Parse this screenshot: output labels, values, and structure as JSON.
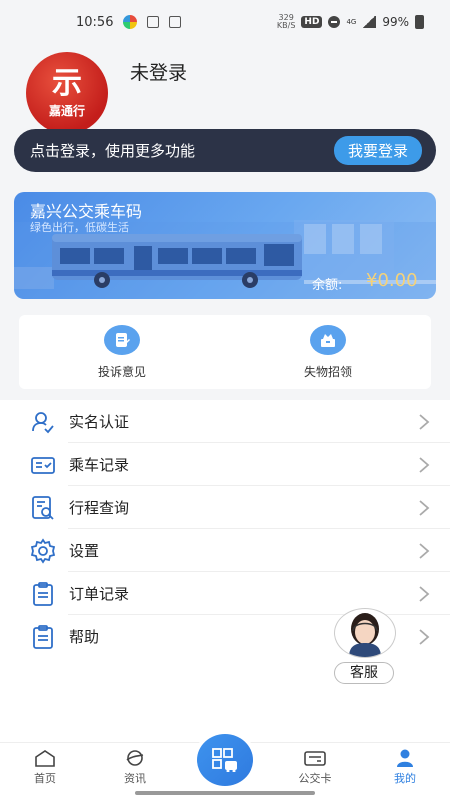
{
  "status_bar": {
    "time": "10:56",
    "speed_value": "329",
    "speed_unit": "KB/S",
    "hd": "HD",
    "network": "4G",
    "battery": "99%"
  },
  "profile": {
    "logo_glyph": "示",
    "logo_text": "嘉通行",
    "username": "未登录"
  },
  "login_banner": {
    "text": "点击登录，使用更多功能",
    "button_label": "我要登录"
  },
  "bus_card": {
    "title": "嘉兴公交乘车码",
    "subtitle": "绿色出行，低碳生活",
    "balance_label": "余额:",
    "balance_value": "¥0.00"
  },
  "services": [
    {
      "label": "投诉意见",
      "icon": "edit-icon"
    },
    {
      "label": "失物招领",
      "icon": "lost-found-icon"
    }
  ],
  "menu": [
    {
      "label": "实名认证",
      "icon": "user-verify-icon"
    },
    {
      "label": "乘车记录",
      "icon": "ride-record-icon"
    },
    {
      "label": "行程查询",
      "icon": "trip-search-icon"
    },
    {
      "label": "设置",
      "icon": "gear-icon"
    },
    {
      "label": "订单记录",
      "icon": "order-clipboard-icon"
    },
    {
      "label": "帮助",
      "icon": "help-clipboard-icon"
    }
  ],
  "customer_service": {
    "label": "客服"
  },
  "tabbar": {
    "home": "首页",
    "news": "资讯",
    "card": "公交卡",
    "mine": "我的",
    "active_color": "#2f80e0"
  },
  "colors": {
    "accent": "#3d9be9",
    "banner_bg": "#2c3347",
    "logo_red": "#c41e1b",
    "balance": "#f4d27a"
  }
}
